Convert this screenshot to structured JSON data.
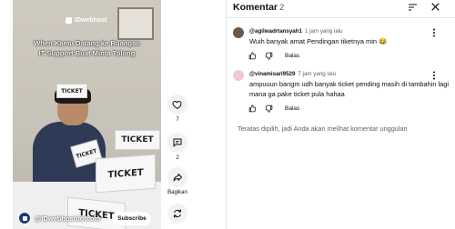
{
  "video": {
    "watermark": "IDwebhost",
    "caption_line1": "When Kamu Datang ke Ruangan",
    "caption_line2": "IT Support Buat Minta Tolong",
    "ticket_labels": [
      "TICKET",
      "TICKET",
      "TICKET",
      "TICKET",
      "TICKET"
    ],
    "channel_name": "@IDwebhostdotcom",
    "subscribe_label": "Subscribe"
  },
  "actions": {
    "like_count": "7",
    "comment_count": "2",
    "share_label": "Bagikan"
  },
  "panel": {
    "title": "Komentar",
    "count": "2",
    "sort_icon": "sort-icon",
    "close_icon": "close-icon"
  },
  "comments": [
    {
      "author": "@agilwadrtansyah1",
      "time": "1 jam yang lalu",
      "text": "Wuih banyak amat Pendingan tiketnya min 😂",
      "reply_label": "Balas"
    },
    {
      "author": "@vinamisari9529",
      "time": "7 jam yang lalu",
      "text": "ampuuun bangm udh banyak ticket pending masih di tambahin lagi mana ga pake ticket pula hahaa",
      "reply_label": "Balas"
    }
  ],
  "footer_note": "Teratas dipilih, jadi Anda akan melihat komentar unggulan",
  "colors": {
    "text_primary": "#0f0f0f",
    "text_secondary": "#606060",
    "button_bg": "#f2f2f2"
  }
}
